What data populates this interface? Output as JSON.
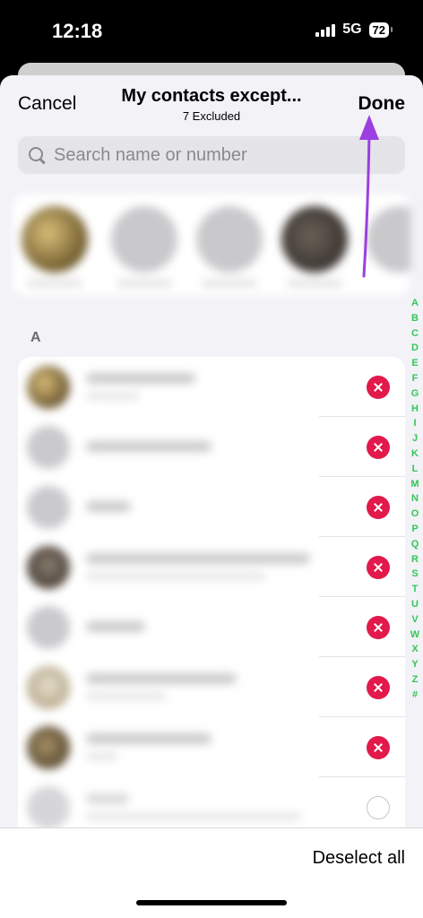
{
  "status_bar": {
    "time": "12:18",
    "network": "5G",
    "battery": "72"
  },
  "header": {
    "cancel_label": "Cancel",
    "title": "My contacts except...",
    "subtitle": "7 Excluded",
    "done_label": "Done"
  },
  "search": {
    "placeholder": "Search name or number"
  },
  "sections": [
    {
      "letter": "A"
    }
  ],
  "contacts": [
    {
      "selected": true
    },
    {
      "selected": true
    },
    {
      "selected": true
    },
    {
      "selected": true
    },
    {
      "selected": true
    },
    {
      "selected": true
    },
    {
      "selected": true
    },
    {
      "selected": false
    }
  ],
  "index_letters": [
    "A",
    "B",
    "C",
    "D",
    "E",
    "F",
    "G",
    "H",
    "I",
    "J",
    "K",
    "L",
    "M",
    "N",
    "O",
    "P",
    "Q",
    "R",
    "S",
    "T",
    "U",
    "V",
    "W",
    "X",
    "Y",
    "Z",
    "#"
  ],
  "footer": {
    "deselect_label": "Deselect all"
  },
  "colors": {
    "accent_check": "#e2194a",
    "index_letters": "#34c759",
    "annotation_arrow": "#9b3fe0"
  }
}
